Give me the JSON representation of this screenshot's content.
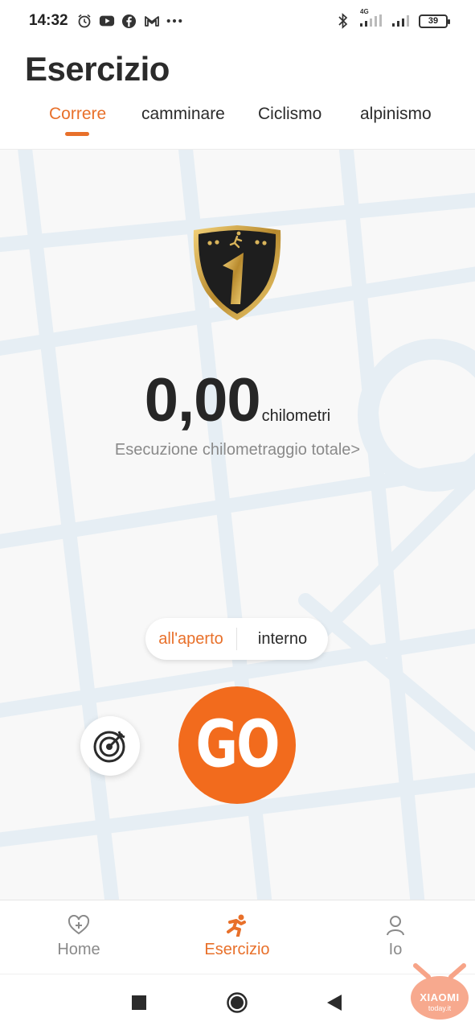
{
  "status_bar": {
    "time": "14:32",
    "battery": "39",
    "network": "4G",
    "icons_left": [
      "alarm-icon",
      "youtube-icon",
      "facebook-icon",
      "gmail-icon",
      "more-dots-icon"
    ],
    "icons_right": [
      "bluetooth-icon",
      "signal-icon",
      "signal-icon",
      "battery-icon"
    ]
  },
  "header": {
    "title": "Esercizio",
    "tabs": [
      {
        "label": "Correre",
        "active": true
      },
      {
        "label": "camminare",
        "active": false
      },
      {
        "label": "Ciclismo",
        "active": false
      },
      {
        "label": "alpinismo",
        "active": false
      }
    ]
  },
  "main": {
    "badge_icon": "runner-rank-1-badge-icon",
    "distance_value": "0,00",
    "distance_unit": "chilometri",
    "total_link": "Esecuzione chilometraggio totale>",
    "mode_options": [
      {
        "label": "all'aperto",
        "active": true
      },
      {
        "label": "interno",
        "active": false
      }
    ],
    "target_icon": "target-icon",
    "go_label": "GO"
  },
  "bottom_nav": [
    {
      "label": "Home",
      "icon": "heart-plus-icon",
      "active": false
    },
    {
      "label": "Esercizio",
      "icon": "running-icon",
      "active": true
    },
    {
      "label": "Io",
      "icon": "person-icon",
      "active": false
    }
  ],
  "system_nav": [
    "recents-square-icon",
    "home-circle-icon",
    "back-triangle-icon"
  ],
  "watermark": {
    "brand": "XIAOMI",
    "site": "today.it"
  },
  "colors": {
    "accent": "#e8702a",
    "go_button": "#f26b1d",
    "text": "#2b2b2b",
    "muted": "#8a8a8a"
  }
}
